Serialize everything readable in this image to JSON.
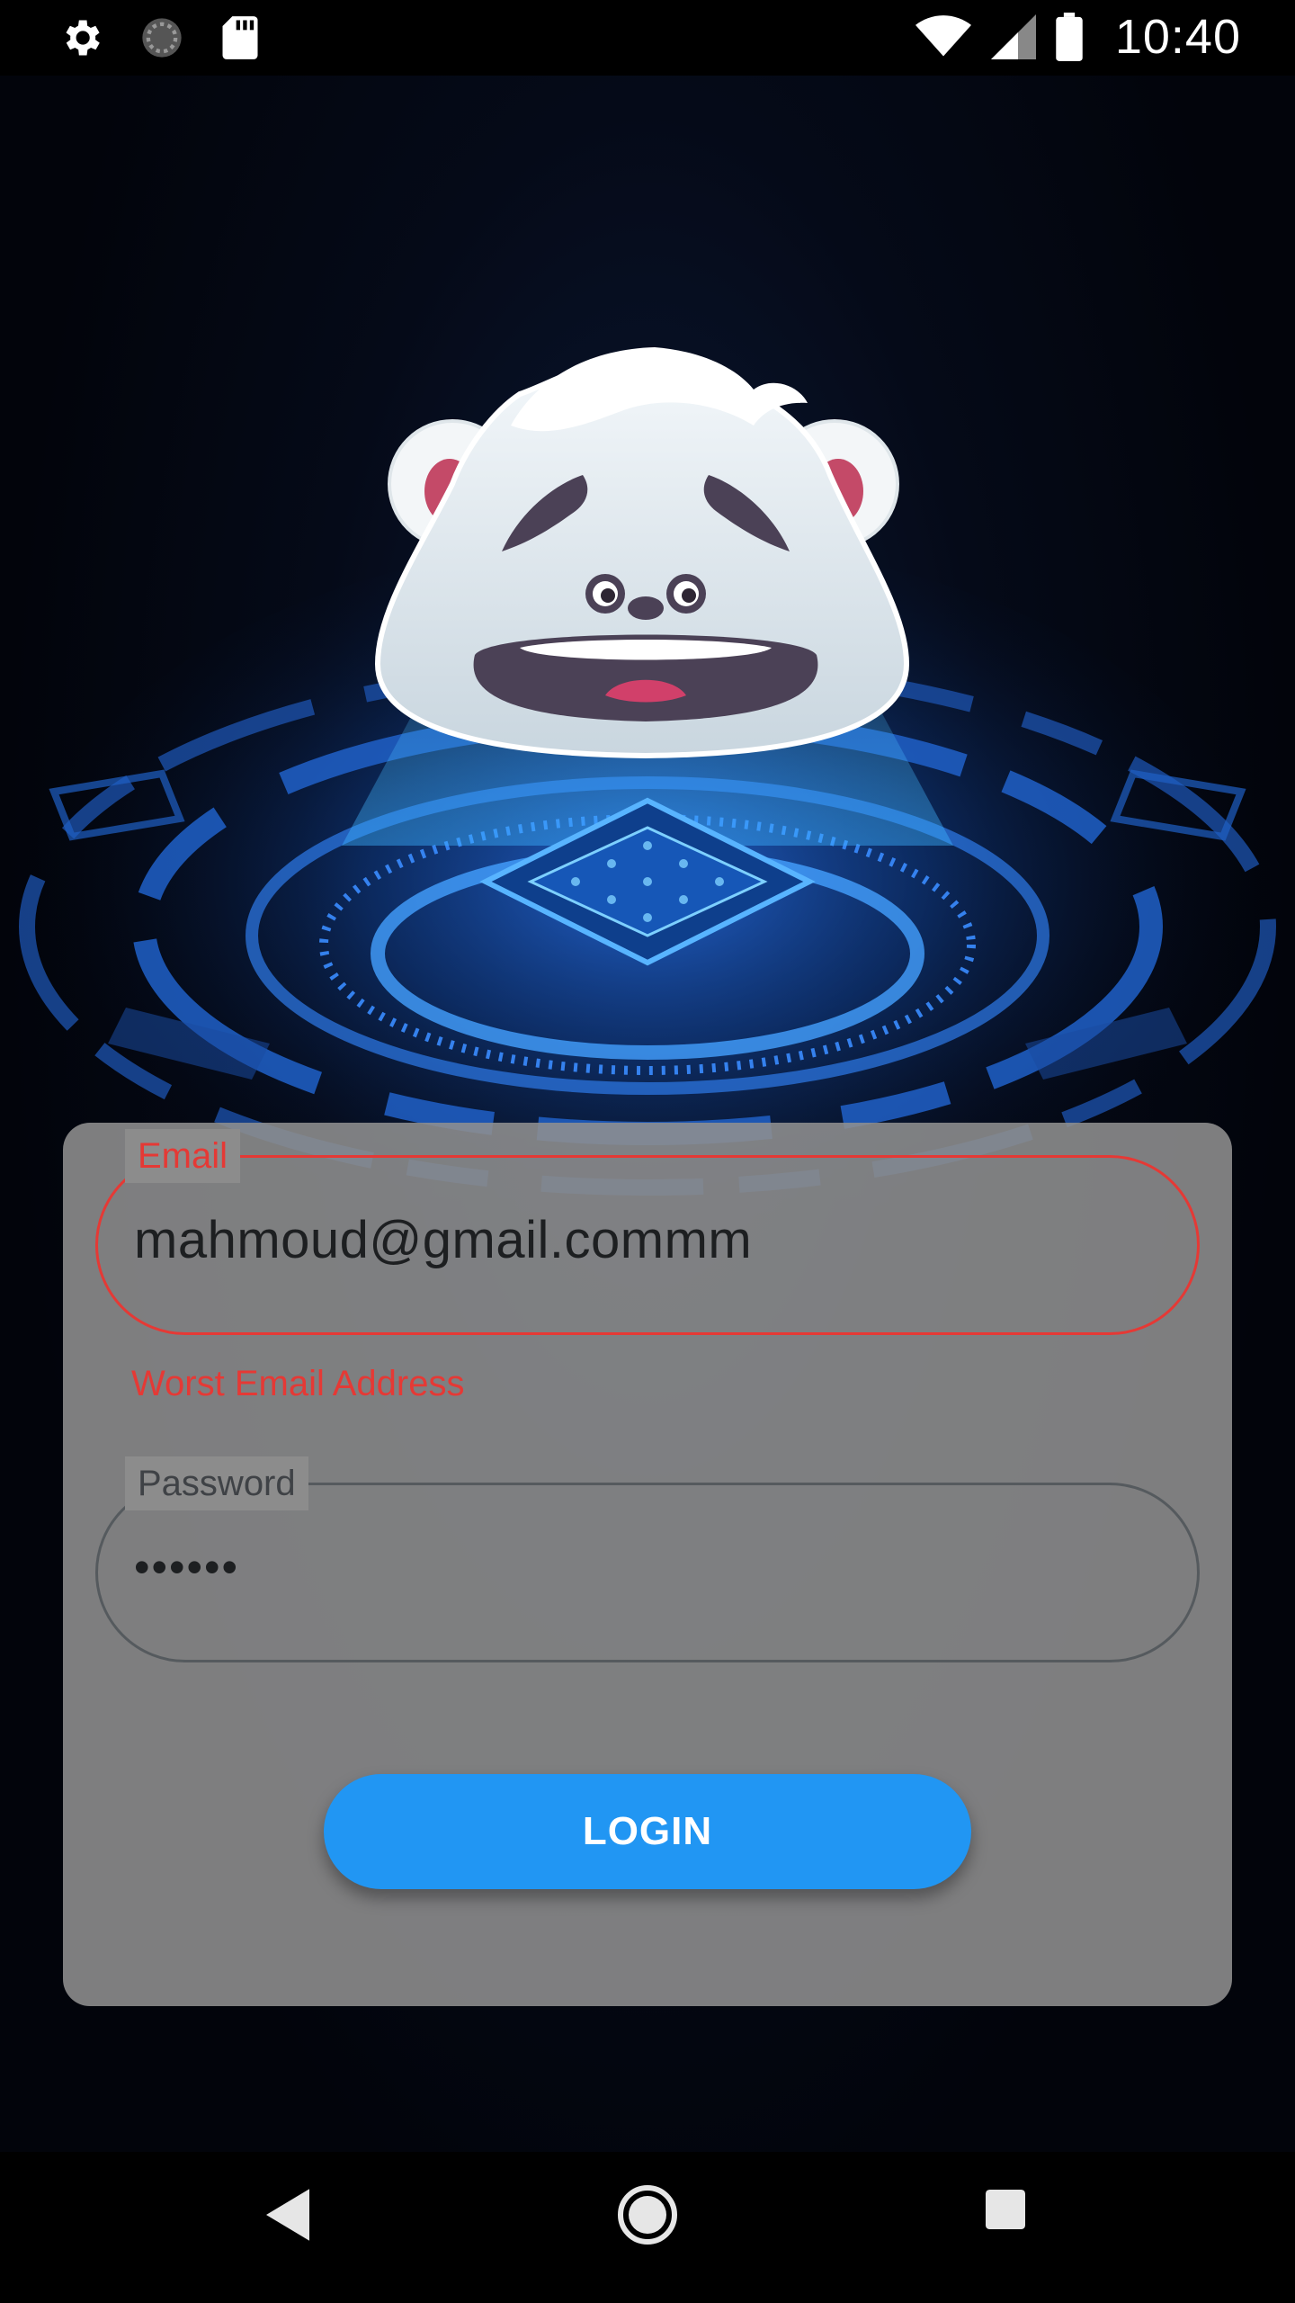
{
  "status_bar": {
    "time": "10:40",
    "left_icons": [
      "settings-icon",
      "sync-icon",
      "sd-card-icon"
    ],
    "right_icons": [
      "wifi-icon",
      "cell-signal-icon",
      "battery-icon"
    ]
  },
  "mascot": {
    "icon": "scared-polar-bear-mascot"
  },
  "form": {
    "email": {
      "label": "Email",
      "value": "mahmoud@gmail.commm",
      "error": "Worst Email Address"
    },
    "password": {
      "label": "Password",
      "value": "••••••"
    },
    "login_label": "LOGIN"
  },
  "nav_bar": {
    "buttons": [
      "back-icon",
      "home-icon",
      "recents-icon"
    ]
  },
  "colors": {
    "accent": "#2196f3",
    "error": "#e53935",
    "card": "#8f8f8f"
  }
}
